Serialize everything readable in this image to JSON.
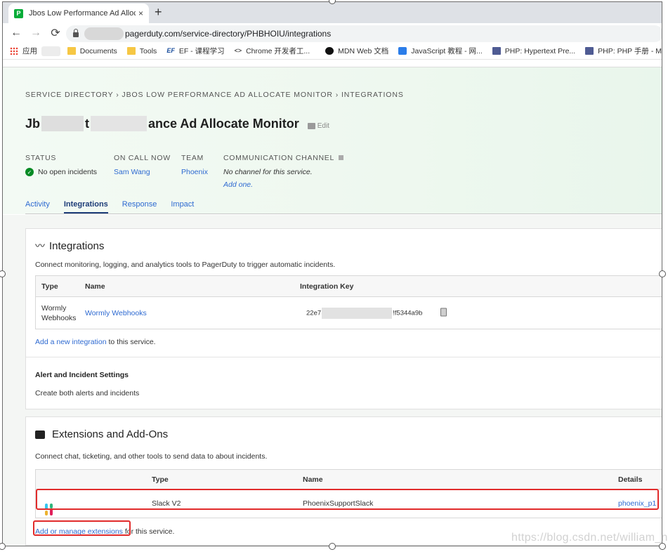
{
  "browser": {
    "tab_title": "Jbos Low Performance Ad Allocat",
    "favicon_letter": "P",
    "close_glyph": "×",
    "new_tab_glyph": "+",
    "url": "pagerduty.com/service-directory/PHBHOIU/integrations",
    "bookmarks": [
      {
        "label": "应用",
        "icon": "apps-icon"
      },
      {
        "label": "Documents",
        "icon": "folder-icon"
      },
      {
        "label": "Tools",
        "icon": "folder-icon"
      },
      {
        "label": "EF - 课程学习",
        "icon": "ef-icon"
      },
      {
        "label": "Chrome 开发者工...",
        "icon": "code-icon"
      },
      {
        "label": "MDN Web 文档",
        "icon": "mdn-icon"
      },
      {
        "label": "JavaScript 教程 - 网...",
        "icon": "w-icon"
      },
      {
        "label": "PHP: Hypertext Pre...",
        "icon": "php-icon"
      },
      {
        "label": "PHP: PHP 手册 - M",
        "icon": "php-icon"
      }
    ]
  },
  "service": {
    "breadcrumb": "SERVICE DIRECTORY › JBOS LOW PERFORMANCE AD ALLOCATE MONITOR › INTEGRATIONS",
    "title_start": "Jb",
    "title_mid": "t",
    "title_end": "ance Ad Allocate Monitor",
    "edit_label": "Edit",
    "status_label": "STATUS",
    "status_value": "No open incidents",
    "oncall_label": "ON CALL NOW",
    "oncall_value": "Sam Wang",
    "team_label": "TEAM",
    "team_value": "Phoenix",
    "comm_label": "COMMUNICATION CHANNEL",
    "comm_value": "No channel for this service.",
    "comm_add": "Add one.",
    "tabs": [
      "Activity",
      "Integrations",
      "Response",
      "Impact"
    ]
  },
  "integrations": {
    "heading": "Integrations",
    "description": "Connect monitoring, logging, and analytics tools to PagerDuty to trigger automatic incidents.",
    "columns": [
      "Type",
      "Name",
      "Integration Key"
    ],
    "rows": [
      {
        "type_line1": "Wormly",
        "type_line2": "Webhooks",
        "name": "Wormly Webhooks",
        "key_start": "22e7",
        "key_end": "!f5344a9b"
      }
    ],
    "add_link": "Add a new integration",
    "add_suffix": " to this service.",
    "alert_heading": "Alert and Incident Settings",
    "alert_value": "Create both alerts and incidents"
  },
  "extensions": {
    "heading": "Extensions and Add-Ons",
    "description": "Connect chat, ticketing, and other tools to send data to about incidents.",
    "columns": [
      "Type",
      "Name",
      "Details"
    ],
    "rows": [
      {
        "type": "Slack V2",
        "name": "PhoenixSupportSlack",
        "details": "phoenix_p1"
      }
    ],
    "manage_link": "Add or manage extensions",
    "manage_suffix": " for this service."
  },
  "watermark": "https://blog.csdn.net/william_n"
}
